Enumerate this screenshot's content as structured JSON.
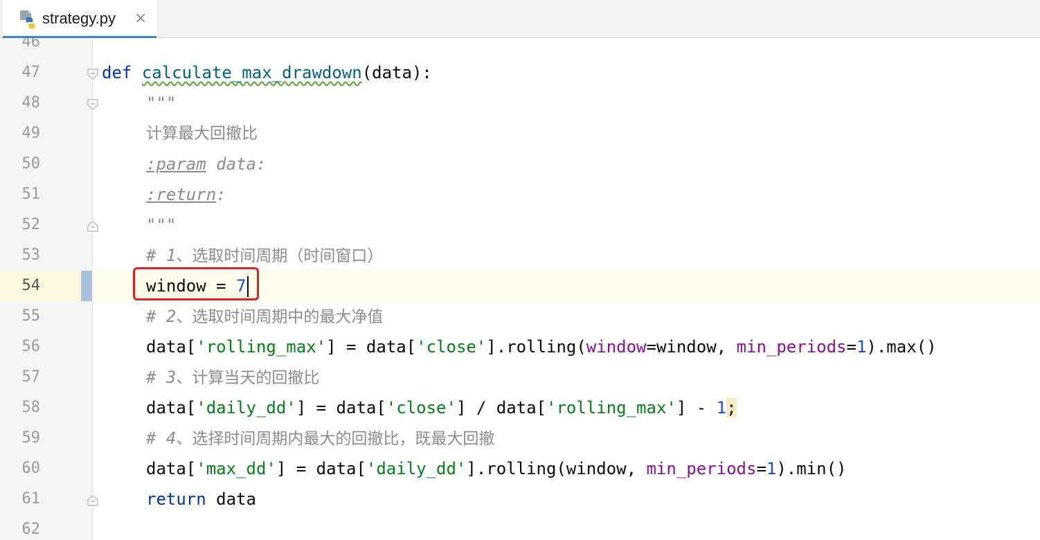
{
  "tab": {
    "title": "strategy.py",
    "close_glyph": "×",
    "icon": "python-file-icon"
  },
  "editor": {
    "current_line": "54",
    "lines": [
      {
        "num": "46",
        "text": ""
      },
      {
        "num": "47",
        "text": "def calculate_max_drawdown(data):"
      },
      {
        "num": "48",
        "text": "\"\"\""
      },
      {
        "num": "49",
        "text": "计算最大回撤比"
      },
      {
        "num": "50",
        "text": ":param data:"
      },
      {
        "num": "51",
        "text": ":return:"
      },
      {
        "num": "52",
        "text": "\"\"\""
      },
      {
        "num": "53",
        "text": "# 1、选取时间周期（时间窗口）"
      },
      {
        "num": "54",
        "text": "window = 7"
      },
      {
        "num": "55",
        "text": "# 2、选取时间周期中的最大净值"
      },
      {
        "num": "56",
        "text": "data['rolling_max'] = data['close'].rolling(window=window, min_periods=1).max()"
      },
      {
        "num": "57",
        "text": "# 3、计算当天的回撤比"
      },
      {
        "num": "58",
        "text": "data['daily_dd'] = data['close'] / data['rolling_max'] - 1;"
      },
      {
        "num": "59",
        "text": "# 4、选择时间周期内最大的回撤比，既最大回撤"
      },
      {
        "num": "60",
        "text": "data['max_dd'] = data['daily_dd'].rolling(window, min_periods=1).min()"
      },
      {
        "num": "61",
        "text": "return data"
      },
      {
        "num": "62",
        "text": ""
      }
    ],
    "tokens": {
      "def": "def",
      "fn_name": "calculate_max_drawdown",
      "sig_rest": "(data):",
      "docquote": "\"\"\"",
      "doc_text": "计算最大回撤比",
      "param_tag": ":param",
      "param_rest": " data:",
      "return_tag": ":return",
      "return_rest": ":",
      "c1_hash": "# 1",
      "c1_text": "、选取时间周期（时间窗口）",
      "win_lhs": "window = ",
      "win_val": "7",
      "c2_hash": "# 2",
      "c2_text": "、选取时间周期中的最大净值",
      "l56_a": "data[",
      "l56_s1": "'rolling_max'",
      "l56_b": "] = data[",
      "l56_s2": "'close'",
      "l56_c": "].rolling(",
      "l56_p1": "window",
      "l56_d": "=window, ",
      "l56_p2": "min_periods",
      "l56_e": "=",
      "l56_n": "1",
      "l56_f": ").max()",
      "c3_hash": "# 3",
      "c3_text": "、计算当天的回撤比",
      "l58_a": "data[",
      "l58_s1": "'daily_dd'",
      "l58_b": "] = data[",
      "l58_s2": "'close'",
      "l58_c": "] / data[",
      "l58_s3": "'rolling_max'",
      "l58_d": "] - ",
      "l58_n": "1",
      "l58_semi": ";",
      "c4_hash": "# 4",
      "c4_text": "、选择时间周期内最大的回撤比，既最大回撤",
      "l60_a": "data[",
      "l60_s1": "'max_dd'",
      "l60_b": "] = data[",
      "l60_s2": "'daily_dd'",
      "l60_c": "].rolling(window, ",
      "l60_p": "min_periods",
      "l60_e": "=",
      "l60_n": "1",
      "l60_f": ").min()",
      "ret_kw": "return",
      "ret_rest": " data"
    }
  },
  "colors": {
    "keyword": "#0033b3",
    "function": "#00627a",
    "string": "#067d17",
    "number": "#1750eb",
    "named_param": "#871094",
    "comment": "#8c8c8c",
    "highlight_box": "#e02020"
  }
}
